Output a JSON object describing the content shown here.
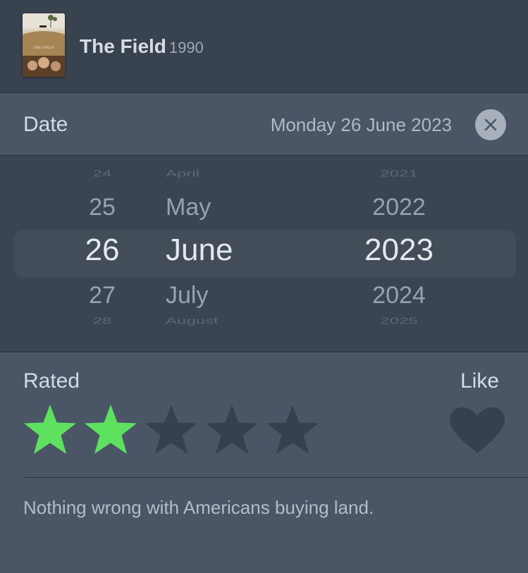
{
  "film": {
    "title": "The Field",
    "year": "1990",
    "poster_text": "THE FIELD"
  },
  "date": {
    "label": "Date",
    "value": "Monday 26 June 2023"
  },
  "picker": {
    "days": [
      "24",
      "25",
      "26",
      "27",
      "28"
    ],
    "months": [
      "April",
      "May",
      "June",
      "July",
      "August"
    ],
    "years": [
      "2021",
      "2022",
      "2023",
      "2024",
      "2025"
    ],
    "selected_index": 2
  },
  "rating": {
    "label": "Rated",
    "stars_filled": 2,
    "stars_total": 5,
    "filled_color": "#5ee15e",
    "empty_color": "#37414e"
  },
  "like": {
    "label": "Like",
    "liked": false,
    "color": "#37414e"
  },
  "review": {
    "text": "Nothing wrong with Americans buying land."
  }
}
